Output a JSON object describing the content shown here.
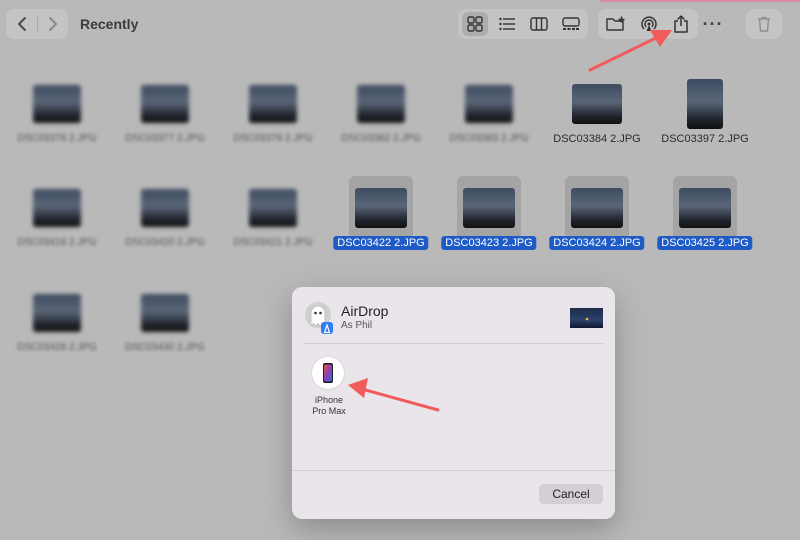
{
  "window": {
    "title": "Recently"
  },
  "toolbar": {
    "back_icon": "chevron-left-icon",
    "forward_icon": "chevron-right-icon",
    "view_modes": [
      "grid-view-icon",
      "list-view-icon",
      "column-view-icon",
      "gallery-view-icon"
    ],
    "active_view": "grid-view-icon",
    "actions": [
      "new-folder-icon",
      "airdrop-icon",
      "share-icon"
    ],
    "more_label": "···",
    "trash_icon": "trash-icon"
  },
  "files": [
    {
      "name": "DSC03378 2.JPG",
      "blurred": true,
      "selected": false
    },
    {
      "name": "DSC03377 2.JPG",
      "blurred": true,
      "selected": false
    },
    {
      "name": "DSC03379 2.JPG",
      "blurred": true,
      "selected": false
    },
    {
      "name": "DSC03382 2.JPG",
      "blurred": true,
      "selected": false
    },
    {
      "name": "DSC03383 2.JPG",
      "blurred": true,
      "selected": false
    },
    {
      "name": "DSC03384 2.JPG",
      "blurred": false,
      "selected": false
    },
    {
      "name": "DSC03397 2.JPG",
      "blurred": false,
      "selected": false
    },
    {
      "name": "DSC03418 2.JPG",
      "blurred": true,
      "selected": false
    },
    {
      "name": "DSC03420 2.JPG",
      "blurred": true,
      "selected": false
    },
    {
      "name": "DSC03421 2.JPG",
      "blurred": true,
      "selected": false
    },
    {
      "name": "DSC03422 2.JPG",
      "blurred": false,
      "selected": true
    },
    {
      "name": "DSC03423 2.JPG",
      "blurred": false,
      "selected": true
    },
    {
      "name": "DSC03424 2.JPG",
      "blurred": false,
      "selected": true
    },
    {
      "name": "DSC03425 2.JPG",
      "blurred": false,
      "selected": true
    },
    {
      "name": "DSC03428 2.JPG",
      "blurred": true,
      "selected": false
    },
    {
      "name": "DSC03430 2.JPG",
      "blurred": true,
      "selected": false
    }
  ],
  "airdrop": {
    "title": "AirDrop",
    "subtitle": "As Phil",
    "avatar_icon": "ghost-avatar-icon",
    "device": {
      "name_line1": "iPhone",
      "name_line2": "Pro Max",
      "icon": "iphone-icon"
    },
    "cancel_label": "Cancel"
  },
  "colors": {
    "selection": "#1e5bc6",
    "annotation_arrow": "#f25b5b"
  }
}
